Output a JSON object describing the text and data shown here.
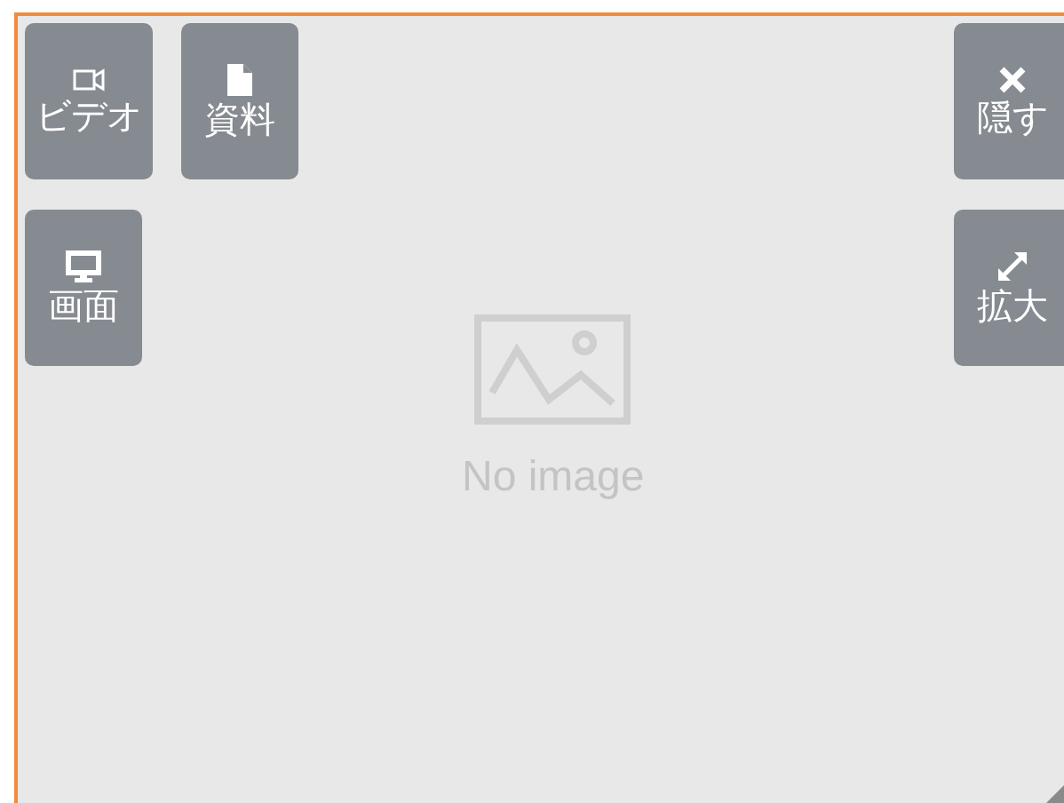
{
  "left_buttons": [
    {
      "kind": "video",
      "label": "ビデオ"
    },
    {
      "kind": "document",
      "label": "資料"
    },
    {
      "kind": "screen",
      "label": "画面"
    }
  ],
  "right_buttons": [
    {
      "kind": "hide",
      "label": "隠す"
    },
    {
      "kind": "expand",
      "label": "拡大"
    }
  ],
  "placeholder": {
    "text": "No image"
  }
}
